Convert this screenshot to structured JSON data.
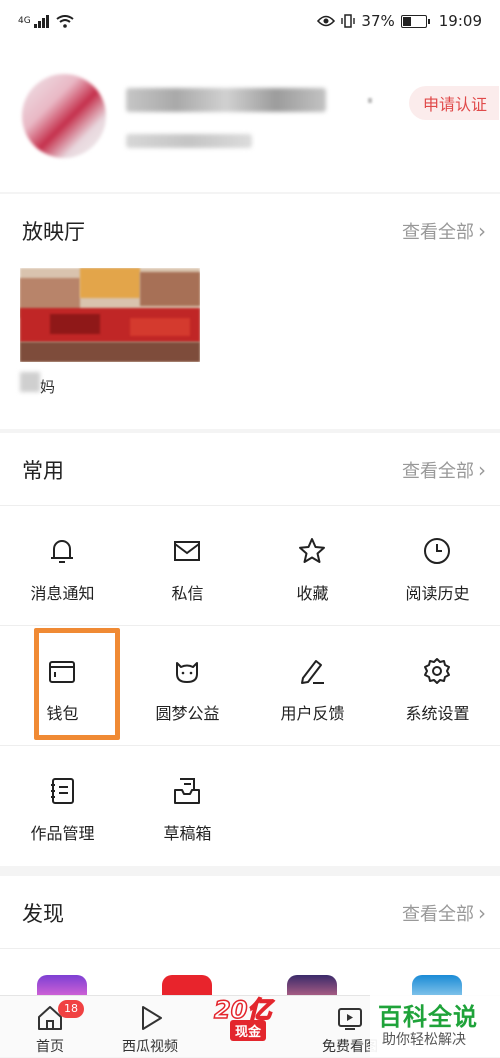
{
  "status_bar": {
    "network": "4G",
    "battery": "37%",
    "battery_level": 0.37,
    "time": "19:09"
  },
  "profile": {
    "apply_label": "申请认证"
  },
  "hall": {
    "title": "放映厅",
    "more": "查看全部",
    "video_caption": "妈"
  },
  "common": {
    "title": "常用",
    "more": "查看全部",
    "items": [
      {
        "label": "消息通知",
        "icon": "bell-icon"
      },
      {
        "label": "私信",
        "icon": "mail-icon"
      },
      {
        "label": "收藏",
        "icon": "star-icon"
      },
      {
        "label": "阅读历史",
        "icon": "clock-icon"
      },
      {
        "label": "钱包",
        "icon": "wallet-icon"
      },
      {
        "label": "圆梦公益",
        "icon": "charity-icon"
      },
      {
        "label": "用户反馈",
        "icon": "feedback-icon"
      },
      {
        "label": "系统设置",
        "icon": "gear-icon"
      },
      {
        "label": "作品管理",
        "icon": "notebook-icon"
      },
      {
        "label": "草稿箱",
        "icon": "drafts-icon"
      }
    ]
  },
  "discover": {
    "title": "发现",
    "more": "查看全部"
  },
  "bottom_nav": {
    "home": "首页",
    "home_badge": "18",
    "xigua": "西瓜视频",
    "promo_big": "20亿",
    "promo_small": "现金",
    "free": "免费看图"
  },
  "watermark": {
    "title": "百科全说",
    "subtitle": "助你轻松解决"
  },
  "colors": {
    "accent": "#f04142",
    "highlight": "#f08a34",
    "watermark": "#1fa33a"
  }
}
